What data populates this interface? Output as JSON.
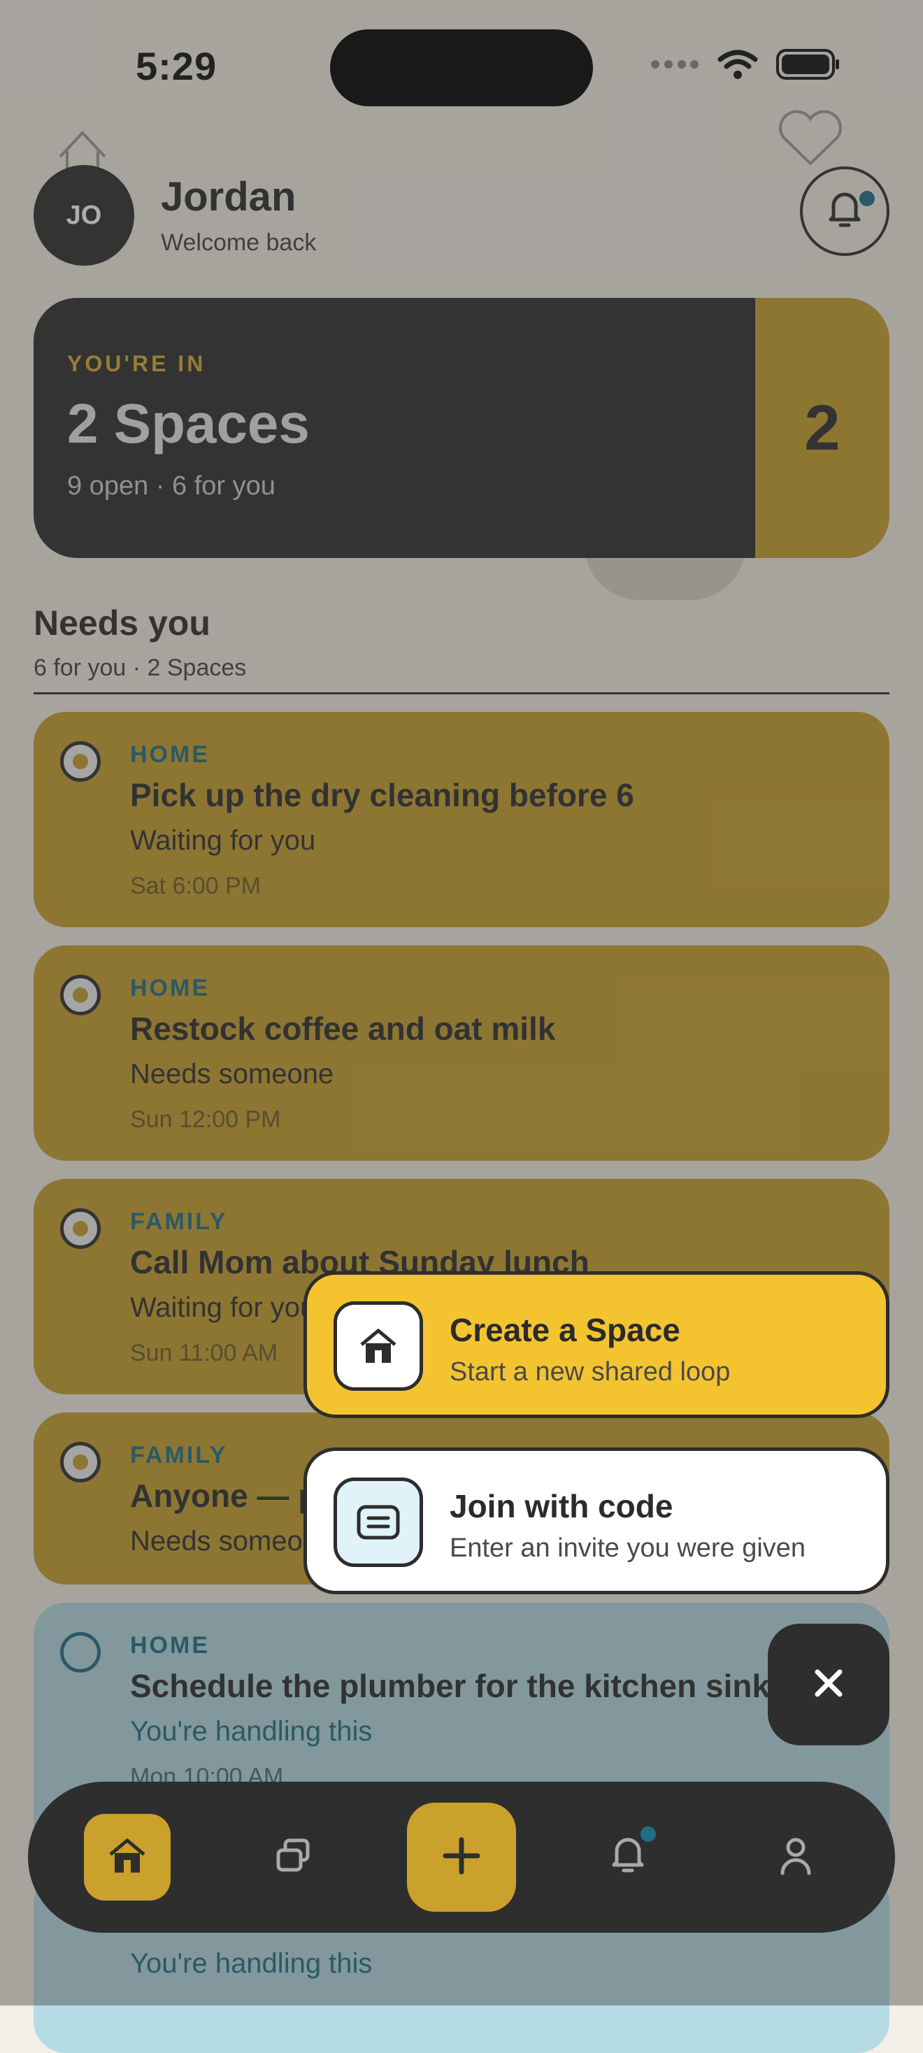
{
  "status_bar": {
    "time": "5:29"
  },
  "header": {
    "avatar_initials": "JO",
    "name": "Jordan",
    "greeting": "Welcome back",
    "notification_icon": "bell-icon"
  },
  "spaces_card": {
    "eyebrow": "YOU'RE IN",
    "title": "2 Spaces",
    "subtitle": "9 open · 6 for you",
    "count": "2"
  },
  "needs_you": {
    "title": "Needs you",
    "subtitle": "6 for you · 2 Spaces",
    "tasks": [
      {
        "space": "HOME",
        "title": "Pick up the dry cleaning before 6",
        "status": "Waiting for you",
        "time": "Sat 6:00 PM"
      },
      {
        "space": "HOME",
        "title": "Restock coffee and oat milk",
        "status": "Needs someone",
        "time": "Sun 12:00 PM"
      },
      {
        "space": "FAMILY",
        "title": "Call Mom about Sunday lunch",
        "status": "Waiting for you",
        "time": "Sun 11:00 AM"
      },
      {
        "space": "FAMILY",
        "title": "Anyone — p",
        "status": "Needs someone",
        "time": ""
      },
      {
        "space": "HOME",
        "title": "Schedule the plumber for the kitchen sink",
        "status": "You're handling this",
        "time": "Mon 10:00 AM"
      },
      {
        "space": "",
        "title": "",
        "status": "You're handling this",
        "time": ""
      }
    ]
  },
  "actions": {
    "create": {
      "title": "Create a Space",
      "subtitle": "Start a new shared loop",
      "icon": "house-icon"
    },
    "join": {
      "title": "Join with code",
      "subtitle": "Enter an invite you were given",
      "icon": "ticket-icon"
    },
    "close_icon": "close-icon"
  },
  "nav": {
    "items": [
      "home-icon",
      "spaces-icon",
      "plus-icon",
      "bell-icon",
      "profile-icon"
    ]
  },
  "colors": {
    "accent_gold": "#c9a12c",
    "create_yellow": "#f4c430",
    "teal": "#1f6f86",
    "dark": "#2e2e2e"
  }
}
